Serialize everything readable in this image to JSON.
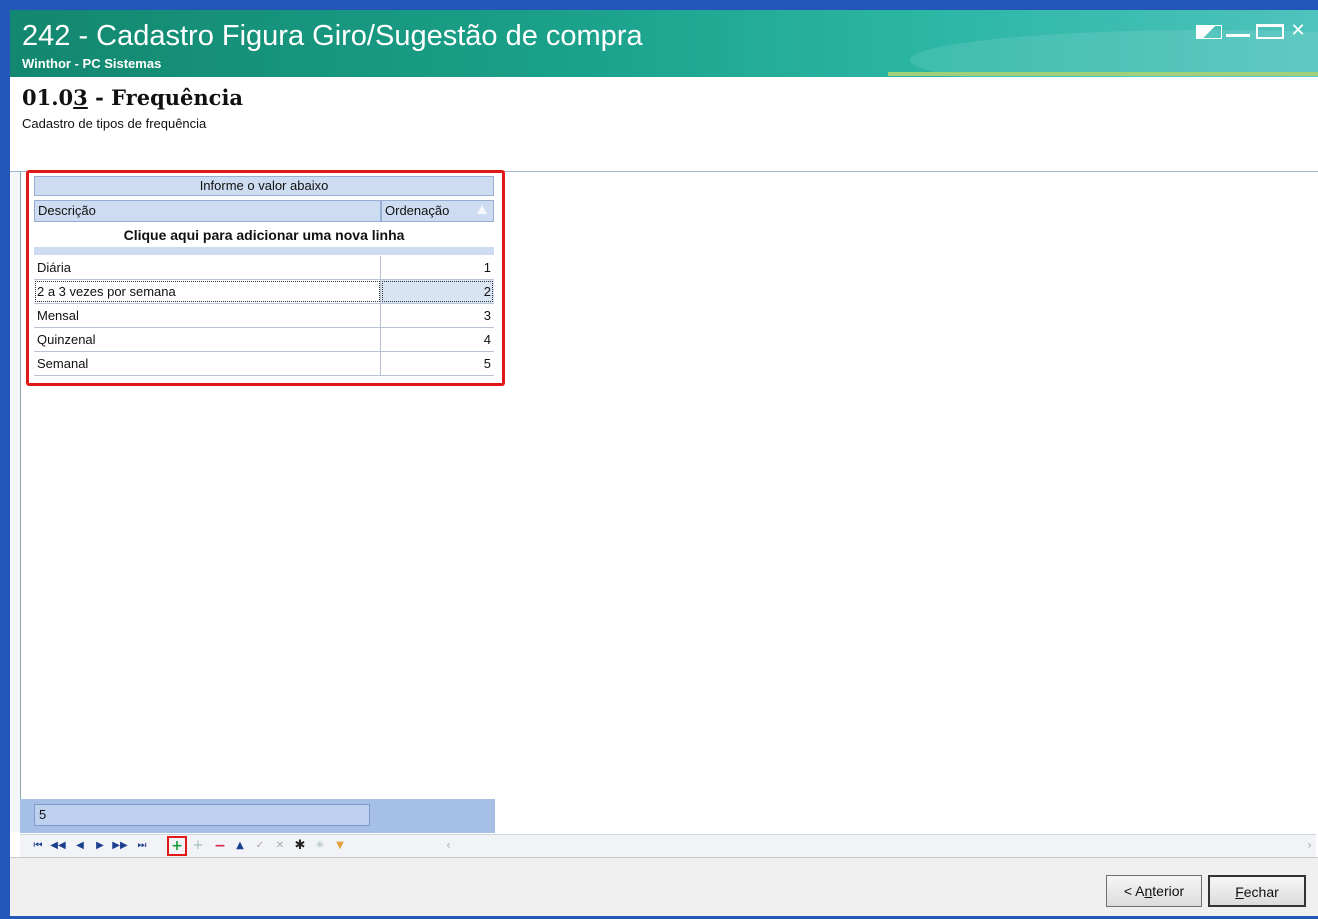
{
  "window": {
    "title": "242 - Cadastro Figura Giro/Sugestão de compra",
    "subtitle": "Winthor - PC Sistemas"
  },
  "step": {
    "code_prefix": "01.0",
    "code_underlined": "3",
    "code_suffix": " - Frequência",
    "description": "Cadastro de tipos de frequência"
  },
  "grid": {
    "group_header": "Informe o valor abaixo",
    "columns": [
      "Descrição",
      "Ordenação"
    ],
    "new_row_prompt": "Clique aqui para adicionar uma nova linha",
    "rows": [
      {
        "descricao": "Diária",
        "ordenacao": "1"
      },
      {
        "descricao": "2 a 3 vezes por semana",
        "ordenacao": "2",
        "selected": true
      },
      {
        "descricao": "Mensal",
        "ordenacao": "3"
      },
      {
        "descricao": "Quinzenal",
        "ordenacao": "4"
      },
      {
        "descricao": "Semanal",
        "ordenacao": "5"
      }
    ],
    "footer_count": "5"
  },
  "navigator": {
    "buttons": [
      "first-icon",
      "prev-page-icon",
      "prev-icon",
      "next-icon",
      "next-page-icon",
      "last-icon",
      "insert-icon",
      "append-icon",
      "delete-icon",
      "edit-icon",
      "post-icon",
      "cancel-icon",
      "refresh-icon",
      "bookmark-icon",
      "filter-icon"
    ]
  },
  "buttons": {
    "anterior_prefix": "< A",
    "anterior_underlined": "n",
    "anterior_suffix": "terior",
    "fechar_underlined": "F",
    "fechar_suffix": "echar"
  },
  "colors": {
    "title_gradient_start": "#13876f",
    "highlight_red": "#e21818",
    "grid_header": "#cddcf0"
  }
}
